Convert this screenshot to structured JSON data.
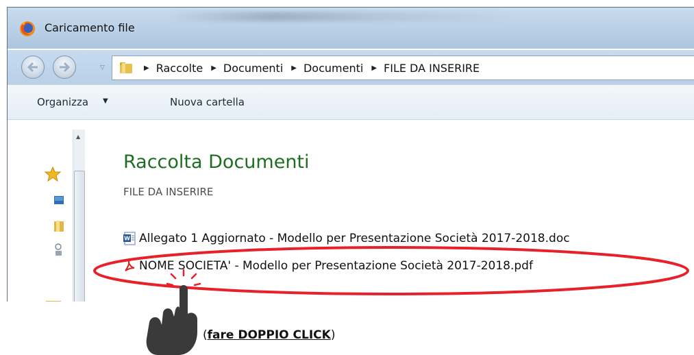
{
  "window": {
    "title": "Caricamento file",
    "app_icon": "firefox-icon"
  },
  "address": {
    "folder_icon": "folder-icon",
    "breadcrumbs": [
      "Raccolte",
      "Documenti",
      "Documenti",
      "FILE DA INSERIRE"
    ]
  },
  "toolbar": {
    "organize_label": "Organizza",
    "new_folder_label": "Nuova cartella"
  },
  "navpane": {
    "icons": [
      "favorites-star-icon",
      "desktop-icon",
      "folder-icon",
      "network-icon"
    ]
  },
  "library": {
    "title": "Raccolta Documenti",
    "subtitle": "FILE DA INSERIRE"
  },
  "files": [
    {
      "name": "Allegato 1 Aggiornato - Modello per Presentazione Società 2017-2018.doc",
      "icon": "word-doc-icon"
    },
    {
      "name": "NOME SOCIETA' - Modello per Presentazione Società 2017-2018.pdf",
      "icon": "pdf-icon"
    }
  ],
  "annotation": {
    "open_paren": "(",
    "instruction": "fare DOPPIO CLICK",
    "close_paren": ")",
    "highlight_color": "#e8202a",
    "hand_color": "#3a3a3a"
  },
  "colors": {
    "library_title": "#1e6e22"
  }
}
